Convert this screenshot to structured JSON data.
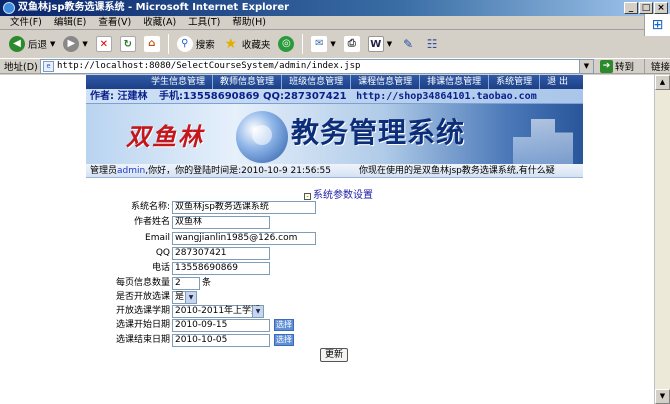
{
  "window": {
    "title": "双鱼林jsp教务选课系统 - Microsoft Internet Explorer",
    "minimize": "_",
    "maximize": "□",
    "close": "×"
  },
  "menu": [
    "文件(F)",
    "编辑(E)",
    "查看(V)",
    "收藏(A)",
    "工具(T)",
    "帮助(H)"
  ],
  "toolbar": {
    "back": "后退",
    "search": "搜索",
    "favorites": "收藏夹"
  },
  "address": {
    "label": "地址(D)",
    "url": "http://localhost:8080/SelectCourseSystem/admin/index.jsp",
    "go": "转到",
    "links": "链接"
  },
  "nav": [
    "学生信息管理",
    "教师信息管理",
    "班级信息管理",
    "课程信息管理",
    "排课信息管理",
    "系统管理",
    "退 出"
  ],
  "banner": {
    "author": "作者: 汪建林",
    "phone": "手机:13558690869",
    "qq": "QQ:287307421",
    "url": "http://shop34864101.taobao.com",
    "name": "双鱼林",
    "title": "教务管理系统"
  },
  "status": {
    "prefix": "管理员",
    "user": "admin",
    "login": ",你好，你的登陆时间是:2010-10-9 21:56:55",
    "welcome": "你现在使用的是双鱼林jsp教务选课系统,有什么疑"
  },
  "section_title": "系统参数设置",
  "form": {
    "system_name": {
      "label": "系统名称:",
      "value": "双鱼林jsp教务选课系统"
    },
    "author_name": {
      "label": "作者姓名",
      "value": "双鱼林"
    },
    "email": {
      "label": "Email",
      "value": "wangjianlin1985@126.com"
    },
    "qq": {
      "label": "QQ",
      "value": "287307421"
    },
    "phone": {
      "label": "电话",
      "value": "13558690869"
    },
    "page_size": {
      "label": "每页信息数量",
      "value": "2",
      "unit": "条"
    },
    "open_select": {
      "label": "是否开放选课",
      "value": "是"
    },
    "term": {
      "label": "开放选课学期",
      "value": "2010-2011年上学期"
    },
    "start_date": {
      "label": "选课开始日期",
      "value": "2010-09-15",
      "pick": "选择"
    },
    "end_date": {
      "label": "选课结束日期",
      "value": "2010-10-05",
      "pick": "选择"
    },
    "submit": "更新"
  }
}
